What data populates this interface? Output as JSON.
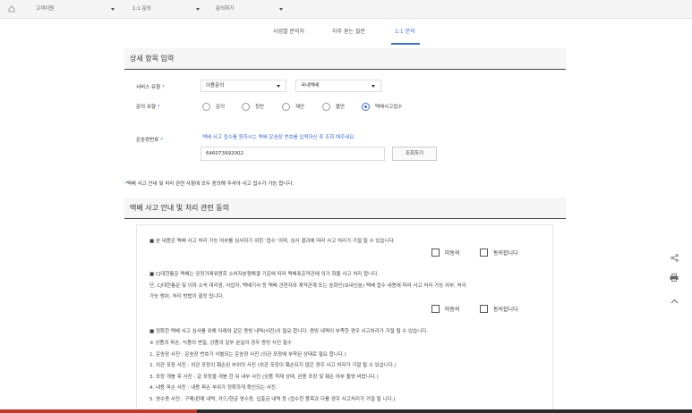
{
  "breadcrumb": {
    "level1": "고객지원",
    "level2": "1:1 문의",
    "level3": "문의하기"
  },
  "tabs": [
    {
      "label": "사업별 문의처"
    },
    {
      "label": "자주 묻는 질문"
    },
    {
      "label": "1:1 문의"
    }
  ],
  "detail": {
    "heading": "상세 항목 입력",
    "service_type_label": "서비스 유형",
    "service_type_value1": "이용문의",
    "service_type_value2": "국내택배",
    "inquiry_type_label": "문의 유형",
    "inquiry_types": [
      "문의",
      "칭찬",
      "제안",
      "불만",
      "택배사고접수"
    ],
    "tracking_label": "운송장번호",
    "tracking_hint": "택배 사고 접수를 원하시는 택배 운송장 번호를 입력하신 후 조회 해주세요.",
    "tracking_value": "646073992002",
    "lookup_button": "조회하기",
    "required_mark": "*"
  },
  "notice": "택배 사고 안내 및 처리 관련 사항에 모두 동의해 주셔야 사고 접수가 가능 합니다.",
  "notice_mark": "*",
  "agreement": {
    "heading": "택배 사고 안내 및 처리 관련 동의",
    "disagree_label": "미동의",
    "agree_label": "동의합니다",
    "p1": "■ 본 내용은 택배 사고 처리 가능 여부를 심사하기 위한 '접수' 이며, 심사 결과에 따라 사고 처리가 거절 될 수 있습니다.",
    "p2a": "■ CJ대한통운 택배는 공정거래위원회 소비자분쟁해결 기준에 따라 택배표준약관에 의거 화물 사고 처리 합니다.",
    "p2b": "단, CJ대한통운 및 이하 소속 대리점, 사업자, 택배기사 등 택배 관련자와 계약관계 또는 송화인(보내신분) 택배 접수 내용에 따라 사고 처리 가능 여부, 처리",
    "p2c": "가능 범위, 처리 방법이 결정 됩니다.",
    "p3": "■ 정확한 택배 사고 심사를 위해 아래와 같은 증빙 내역(사진)이 필요 합니다. 증빙 내역이 부족한 경우 사고처리가 거절 될 수 있습니다.",
    "p4": "※ 상품의 파손, 식품의 변질, 상품의 일부 분실의 경우 증빙 사진 필수",
    "list": [
      "1. 운송장 사진 : 운송장 번호가 식별되는 운송장 사진 (외관 포장에 부착된 상태로 필요 합니다.)",
      "2. 외관 포장 사진 : 외관 포장이 훼손된 부위의 사진 (외관 포장이 훼손되지 않은 경우 사고 처리가 거절 될 수 있습니다.)",
      "3. 포장 개봉 후 사진 : 겉 포장을 개봉 한 뒤 내부 사진 (상품 적재 상태, 완충 포장 및 훼손 여부 촬영 바랍니다.)",
      "4. 내용 파손 사진 : 내용 파손 부위가 정확하게 확인되는 사진.",
      "5. 영수증 사진 : 구매/판매 내역, 카드/현금 영수증, 입출금 내역 등 (접수한 품목과 다를 경우 사고처리가 거절 될 니다.)"
    ]
  },
  "side": {
    "share_icon": "share-icon",
    "print_icon": "print-icon",
    "top_icon": "chevron-up-icon"
  },
  "colors": {
    "accent": "#3a6fd8",
    "heading_border": "#444444",
    "bottom_bar": "#2b2b2b",
    "bottom_bar_red": "#c0392b"
  }
}
